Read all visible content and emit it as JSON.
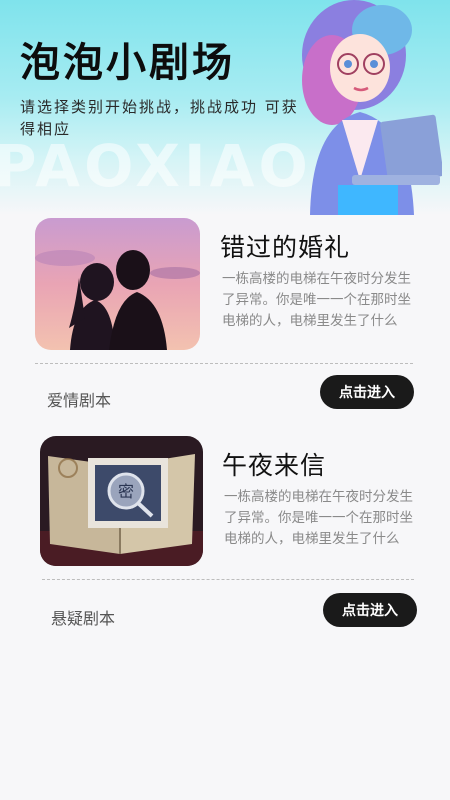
{
  "header": {
    "title": "泡泡小剧场",
    "subtitle": "请选择类别开始挑战，挑战成功 可获得相应",
    "watermark": "PAOXIAO"
  },
  "scripts": [
    {
      "title": "错过的婚礼",
      "description": "一栋高楼的电梯在午夜时分发生了异常。你是唯一一个在那时坐电梯的人，电梯里发生了什么",
      "genre": "爱情剧本",
      "button": "点击进入",
      "image": "couple-sunset-silhouette"
    },
    {
      "title": "午夜来信",
      "description": "一栋高楼的电梯在午夜时分发生了异常。你是唯一一个在那时坐电梯的人，电梯里发生了什么",
      "genre": "悬疑剧本",
      "button": "点击进入",
      "image": "secret-letter-book"
    }
  ],
  "colors": {
    "header_top": "#7fe3ec",
    "button_bg": "#1a1a1a",
    "background": "#f7f7f9"
  }
}
